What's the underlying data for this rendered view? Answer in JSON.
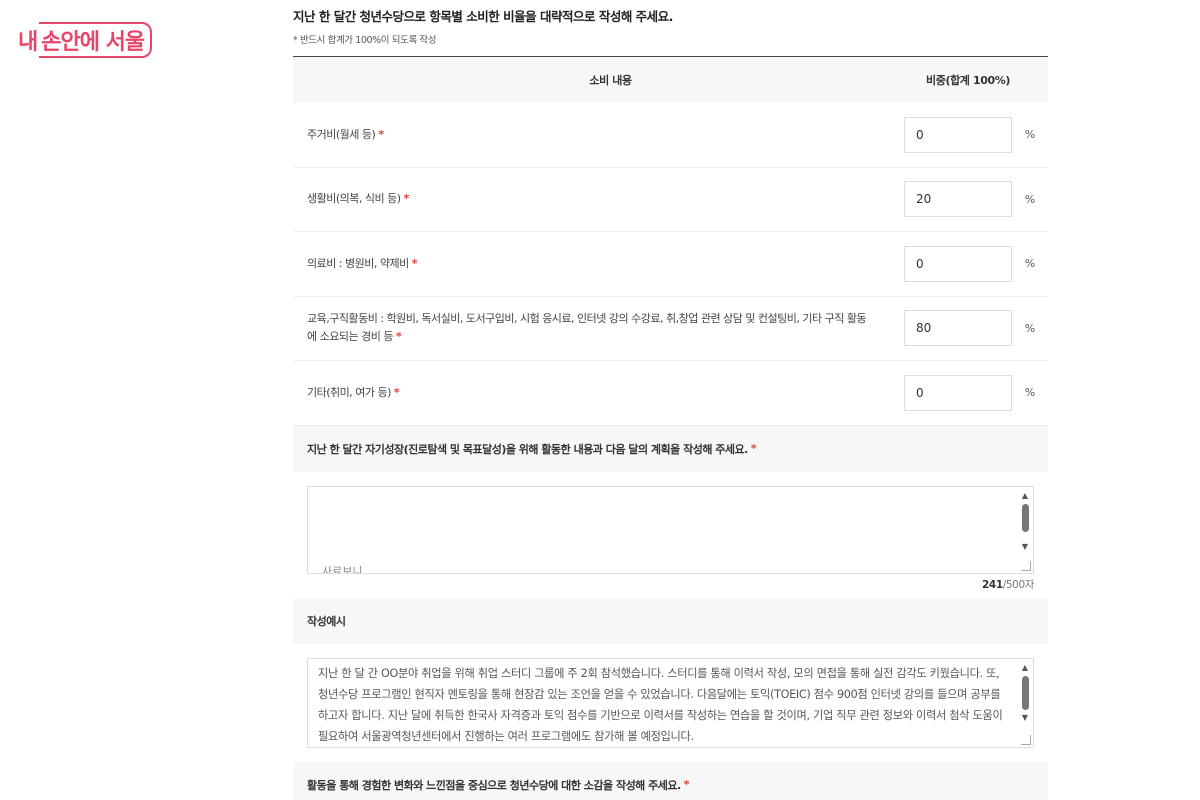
{
  "logo": {
    "part1": "내",
    "part2": "손안에 서울"
  },
  "question1": {
    "title": "지난 한 달간 청년수당으로 항목별 소비한 비율을 대략적으로 작성해 주세요.",
    "note": "* 반드시 합계가 100%이 되도록 작성",
    "headers": {
      "content": "소비 내용",
      "ratio": "비중(합계 100%)"
    },
    "rows": [
      {
        "label": "주거비(월세 등)",
        "value": "0",
        "unit": "%",
        "required": "*"
      },
      {
        "label": "생활비(의복, 식비 등)",
        "value": "20",
        "unit": "%",
        "required": "*"
      },
      {
        "label": "의료비 : 병원비, 약제비",
        "value": "0",
        "unit": "%",
        "required": "*"
      },
      {
        "label": "교육,구직활동비 : 학원비, 독서실비, 도서구입비, 시험 응시료, 인터넷 강의 수강료, 취,창업 관련 상담 및 컨설팅비, 기타 구직 활동에 소요되는 경비 등",
        "value": "80",
        "unit": "%",
        "required": "*"
      },
      {
        "label": "기타(취미, 여가 등)",
        "value": "0",
        "unit": "%",
        "required": "*"
      }
    ]
  },
  "question2": {
    "title": "지난 한 달간 자기성장(진로탐색 및 목표달성)을 위해 활동한 내용과 다음 달의 계획을 작성해 주세요.",
    "required": "*",
    "partial_text": "사료보니",
    "counter_current": "241",
    "counter_max": "/500자"
  },
  "example": {
    "title": "작성예시",
    "text": "지난 한 달 간 OO분야 취업을 위해 취업 스터디 그룹에 주 2회 참석했습니다. 스터디를 통해 이력서 작성, 모의 면접을 통해 실전 감각도 키웠습니다. 또, 청년수당 프로그램인 현직자 멘토링을 통해 현장감 있는 조언을 얻을 수 있었습니다. 다음달에는 토익(TOEIC) 점수 900점 인터넷 강의를 들으며 공부를 하고자 합니다. 지난 달에 취득한 한국사 자격증과 토익 점수를 기반으로 이력서를 작성하는 연습을 할 것이며, 기업 직무 관련 정보와 이력서 첨삭 도움이 필요하여 서울광역청년센터에서 진행하는 여러 프로그램에도 참가해 볼 예정입니다."
  },
  "question3": {
    "title": "활동을 통해 경험한 변화와 느낀점을 중심으로 청년수당에 대한 소감을 작성해 주세요.",
    "required": "*"
  },
  "colors": {
    "accent": "#e8456b",
    "required": "#e23f3f"
  },
  "icons": {
    "scroll_up": "triangle-up",
    "scroll_down": "triangle-down"
  }
}
